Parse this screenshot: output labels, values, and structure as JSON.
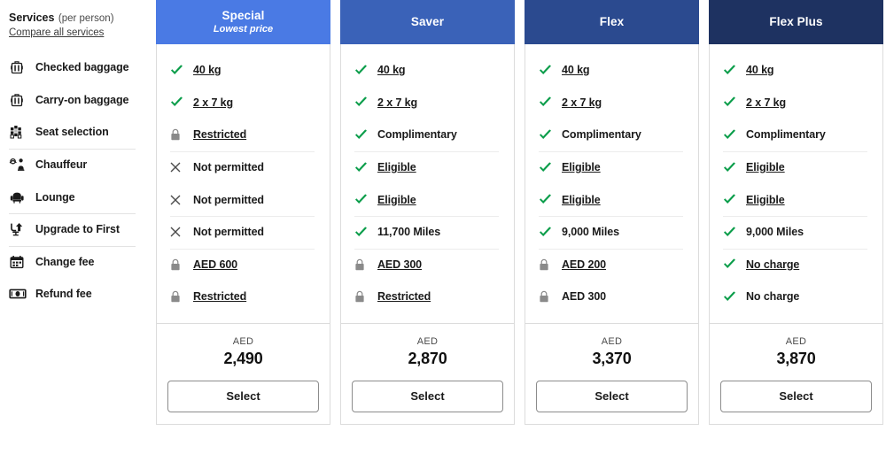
{
  "sidebar": {
    "title": "Services",
    "subtitle": "(per person)",
    "compare_link": "Compare all services",
    "items": [
      {
        "label": "Checked baggage",
        "icon": "checked-baggage-icon",
        "divider_above": false
      },
      {
        "label": "Carry-on baggage",
        "icon": "carry-on-baggage-icon",
        "divider_above": false
      },
      {
        "label": "Seat selection",
        "icon": "seat-selection-icon",
        "divider_above": false
      },
      {
        "label": "Chauffeur",
        "icon": "chauffeur-icon",
        "divider_above": true
      },
      {
        "label": "Lounge",
        "icon": "lounge-icon",
        "divider_above": false
      },
      {
        "label": "Upgrade to First",
        "icon": "upgrade-icon",
        "divider_above": true
      },
      {
        "label": "Change fee",
        "icon": "calendar-icon",
        "divider_above": true
      },
      {
        "label": "Refund fee",
        "icon": "banknote-icon",
        "divider_above": false
      }
    ]
  },
  "colors": {
    "special_header": "#4a7ae4",
    "saver_header": "#3a62b8",
    "flex_header": "#2b4a8f",
    "flexplus_header": "#1e3261",
    "check_green": "#0a9d4a",
    "lock_gray": "#8a8a8a",
    "cross_gray": "#4a4a4a"
  },
  "currency_label": "AED",
  "select_label": "Select",
  "fares": [
    {
      "name": "Special",
      "tag": "Lowest price",
      "header_color": "#4a7ae4",
      "price": "2,490",
      "currency": "AED",
      "select_label": "Select",
      "rows": [
        {
          "icon": "check-icon",
          "text": "40 kg",
          "link": true,
          "divider_above": false
        },
        {
          "icon": "check-icon",
          "text": "2 x 7 kg",
          "link": true,
          "divider_above": false
        },
        {
          "icon": "lock-icon",
          "text": "Restricted",
          "link": true,
          "divider_above": false
        },
        {
          "icon": "cross-icon",
          "text": "Not permitted",
          "link": false,
          "divider_above": true
        },
        {
          "icon": "cross-icon",
          "text": "Not permitted",
          "link": false,
          "divider_above": false
        },
        {
          "icon": "cross-icon",
          "text": "Not permitted",
          "link": false,
          "divider_above": true
        },
        {
          "icon": "lock-icon",
          "text": "AED 600",
          "link": true,
          "divider_above": true
        },
        {
          "icon": "lock-icon",
          "text": "Restricted",
          "link": true,
          "divider_above": false
        }
      ]
    },
    {
      "name": "Saver",
      "tag": "",
      "header_color": "#3a62b8",
      "price": "2,870",
      "currency": "AED",
      "select_label": "Select",
      "rows": [
        {
          "icon": "check-icon",
          "text": "40 kg",
          "link": true,
          "divider_above": false
        },
        {
          "icon": "check-icon",
          "text": "2 x 7 kg",
          "link": true,
          "divider_above": false
        },
        {
          "icon": "check-icon",
          "text": "Complimentary",
          "link": false,
          "divider_above": false
        },
        {
          "icon": "check-icon",
          "text": "Eligible",
          "link": true,
          "divider_above": true
        },
        {
          "icon": "check-icon",
          "text": "Eligible",
          "link": true,
          "divider_above": false
        },
        {
          "icon": "check-icon",
          "text": "11,700 Miles",
          "link": false,
          "divider_above": true
        },
        {
          "icon": "lock-icon",
          "text": "AED 300",
          "link": true,
          "divider_above": true
        },
        {
          "icon": "lock-icon",
          "text": "Restricted",
          "link": true,
          "divider_above": false
        }
      ]
    },
    {
      "name": "Flex",
      "tag": "",
      "header_color": "#2b4a8f",
      "price": "3,370",
      "currency": "AED",
      "select_label": "Select",
      "rows": [
        {
          "icon": "check-icon",
          "text": "40 kg",
          "link": true,
          "divider_above": false
        },
        {
          "icon": "check-icon",
          "text": "2 x 7 kg",
          "link": true,
          "divider_above": false
        },
        {
          "icon": "check-icon",
          "text": "Complimentary",
          "link": false,
          "divider_above": false
        },
        {
          "icon": "check-icon",
          "text": "Eligible",
          "link": true,
          "divider_above": true
        },
        {
          "icon": "check-icon",
          "text": "Eligible",
          "link": true,
          "divider_above": false
        },
        {
          "icon": "check-icon",
          "text": "9,000 Miles",
          "link": false,
          "divider_above": true
        },
        {
          "icon": "lock-icon",
          "text": "AED 200",
          "link": true,
          "divider_above": true
        },
        {
          "icon": "lock-icon",
          "text": "AED 300",
          "link": false,
          "divider_above": false
        }
      ]
    },
    {
      "name": "Flex Plus",
      "tag": "",
      "header_color": "#1e3261",
      "price": "3,870",
      "currency": "AED",
      "select_label": "Select",
      "rows": [
        {
          "icon": "check-icon",
          "text": "40 kg",
          "link": true,
          "divider_above": false
        },
        {
          "icon": "check-icon",
          "text": "2 x 7 kg",
          "link": true,
          "divider_above": false
        },
        {
          "icon": "check-icon",
          "text": "Complimentary",
          "link": false,
          "divider_above": false
        },
        {
          "icon": "check-icon",
          "text": "Eligible",
          "link": true,
          "divider_above": true
        },
        {
          "icon": "check-icon",
          "text": "Eligible",
          "link": true,
          "divider_above": false
        },
        {
          "icon": "check-icon",
          "text": "9,000 Miles",
          "link": false,
          "divider_above": true
        },
        {
          "icon": "check-icon",
          "text": "No charge",
          "link": true,
          "divider_above": true
        },
        {
          "icon": "check-icon",
          "text": "No charge",
          "link": false,
          "divider_above": false
        }
      ]
    }
  ]
}
